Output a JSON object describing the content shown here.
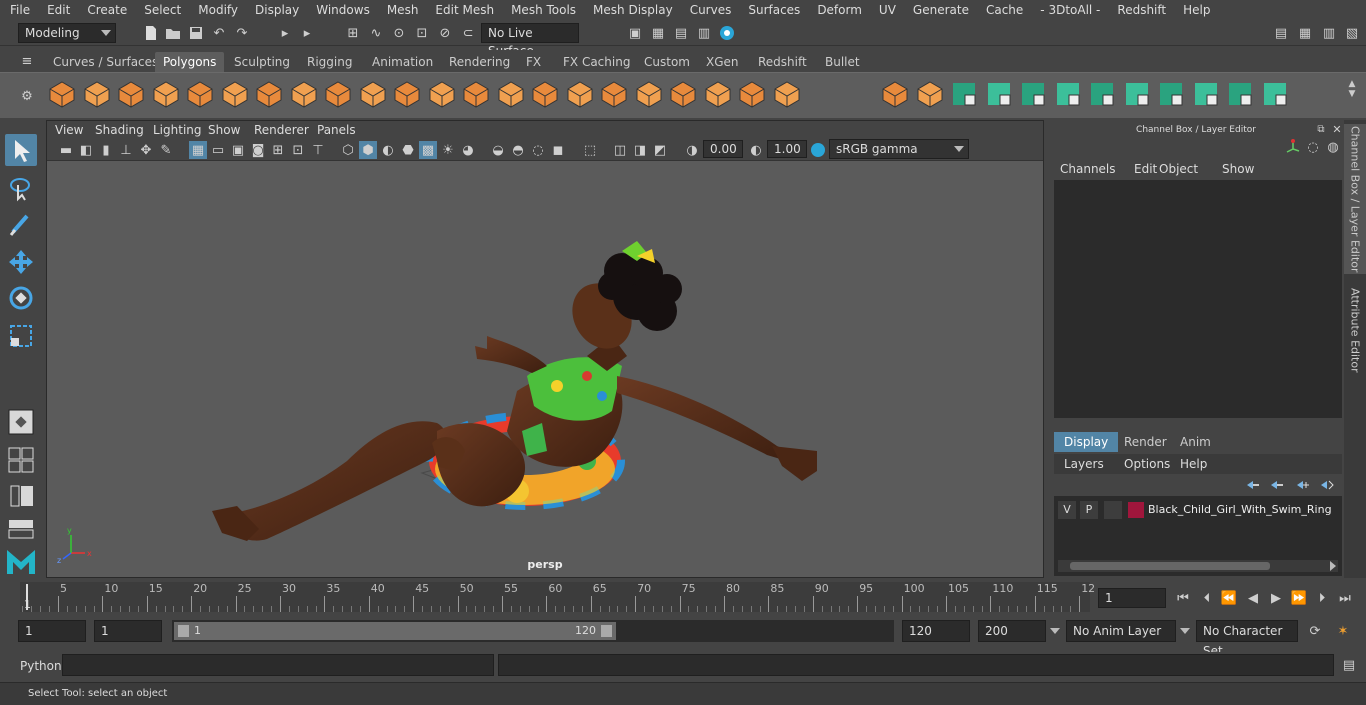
{
  "menus": [
    "File",
    "Edit",
    "Create",
    "Select",
    "Modify",
    "Display",
    "Windows",
    "Mesh",
    "Edit Mesh",
    "Mesh Tools",
    "Mesh Display",
    "Curves",
    "Surfaces",
    "Deform",
    "UV",
    "Generate",
    "Cache",
    "- 3DtoAll -",
    "Redshift",
    "Help"
  ],
  "status": {
    "mode": "Modeling",
    "live_surface": "No Live Surface"
  },
  "shelf_tabs": [
    "Curves / Surfaces",
    "Polygons",
    "Sculpting",
    "Rigging",
    "Animation",
    "Rendering",
    "FX",
    "FX Caching",
    "Custom",
    "XGen",
    "Redshift",
    "Bullet"
  ],
  "active_shelf_tab": "Polygons",
  "viewport": {
    "menus": [
      "View",
      "Shading",
      "Lighting",
      "Show",
      "Renderer",
      "Panels"
    ],
    "exposure": "0.00",
    "gamma": "1.00",
    "color_space": "sRGB gamma",
    "camera_label": "persp"
  },
  "channel_box": {
    "title": "Channel Box / Layer Editor",
    "menus": [
      "Channels",
      "Edit",
      "Object",
      "Show"
    ]
  },
  "layer_editor": {
    "tabs": [
      "Display",
      "Render",
      "Anim"
    ],
    "active_tab": "Display",
    "menus": [
      "Layers",
      "Options",
      "Help"
    ],
    "layers": [
      {
        "v": "V",
        "p": "P",
        "color": "#a0163c",
        "name": "Black_Child_Girl_With_Swim_Ring"
      }
    ]
  },
  "side_tabs": [
    "Channel Box / Layer Editor",
    "Attribute Editor"
  ],
  "timeline": {
    "ticks": [
      "5",
      "10",
      "15",
      "20",
      "25",
      "30",
      "35",
      "40",
      "45",
      "50",
      "55",
      "60",
      "65",
      "70",
      "75",
      "80",
      "85",
      "90",
      "95",
      "100",
      "105",
      "110",
      "115",
      "12"
    ],
    "start_marker": "1",
    "current_frame": "1"
  },
  "range": {
    "start": "1",
    "playback_start": "1",
    "slider_start": "1",
    "slider_end": "120",
    "playback_end": "120",
    "end": "200",
    "anim_layer": "No Anim Layer",
    "character_set": "No Character Set"
  },
  "command": {
    "label": "Python"
  },
  "help_line": "Select Tool: select an object"
}
